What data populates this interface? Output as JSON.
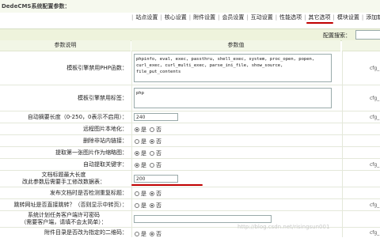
{
  "header": {
    "title": "DedeCMS系统配置参数："
  },
  "tabs": [
    {
      "label": "站点设置",
      "active": false
    },
    {
      "label": "核心设置",
      "active": false
    },
    {
      "label": "附件设置",
      "active": false
    },
    {
      "label": "会员设置",
      "active": false
    },
    {
      "label": "互动设置",
      "active": false
    },
    {
      "label": "性能选项",
      "active": false
    },
    {
      "label": "其它选项",
      "active": true
    },
    {
      "label": "模块设置",
      "active": false
    },
    {
      "label": "添加新变量",
      "active": false
    }
  ],
  "search": {
    "label": "配置搜索：",
    "value": ""
  },
  "columns": {
    "desc": "参数说明",
    "value": "参数值"
  },
  "rows": {
    "php_funcs": {
      "label": "模板引擎禁用PHP函数：",
      "value": "phpinfo, eval, exec, passthru, shell_exec, system, proc_open, popen, curl_exec, curl_multi_exec, parse_ini_file, show_source, file_put_contents",
      "var": "cfg_"
    },
    "tpl_tags": {
      "label": "模板引擎禁用标签：",
      "value": "php",
      "var": "cfg_"
    },
    "auto_desc": {
      "label": "自动摘要长度（0-250，0表示不启用）：",
      "value": "240",
      "var": "cfg_"
    },
    "remote_pic": {
      "label": "远程图片本地化：",
      "yes": "是",
      "no": "否",
      "selected": "yes",
      "var": ""
    },
    "del_links": {
      "label": "删除非站内链接：",
      "yes": "是",
      "no": "否",
      "selected": "no",
      "var": ""
    },
    "first_pic": {
      "label": "提取第一张图片作为缩略图：",
      "yes": "是",
      "no": "否",
      "selected": "yes",
      "var": ""
    },
    "keywords": {
      "label": "自动提取关键字：",
      "yes": "是",
      "no": "否",
      "selected": "yes",
      "var": "cfg_"
    },
    "page_size": {
      "label_line1": "文档标题最大长度",
      "label_line2": "改此参数后需要手工修改数据表：",
      "value": "200",
      "var": ""
    },
    "check_title": {
      "label": "发布文档时是否检测重复标题：",
      "yes": "是",
      "no": "否",
      "selected": "no",
      "var": ""
    },
    "jump": {
      "label": "跳转网址是否直接跳转？（否则显示中转页）：",
      "yes": "是",
      "no": "否",
      "selected": "no",
      "var": "cfg_"
    },
    "client_ip": {
      "label_line1": "系统计划任务客户端许可密码",
      "label_line2": "（需要客户端，请填不会太简单）：",
      "value": "",
      "var": ""
    },
    "qrcode": {
      "label": "附件目录是否改为指定的二维码：",
      "yes": "是",
      "no": "否",
      "selected": "no",
      "var": "cfg_"
    }
  },
  "watermark": "http://blog.csdn.net/risingsun001"
}
